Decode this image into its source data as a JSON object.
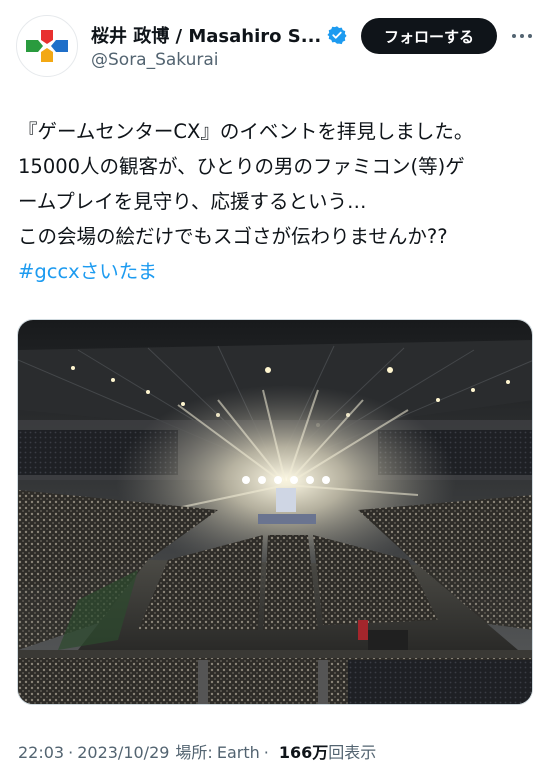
{
  "author": {
    "display_name": "桜井 政博 / Masahiro S...",
    "handle": "@Sora_Sakurai",
    "verified": true
  },
  "follow_button_label": "フォローする",
  "more_icon": "more-horizontal-icon",
  "tweet": {
    "lines": [
      "『ゲームセンターCX』のイベントを拝見しました。",
      "15000人の観客が、ひとりの男のファミコン(等)ゲ",
      "ームプレイを見守り、応援するという…",
      "この会場の絵だけでもスゴさが伝わりませんか??"
    ],
    "hashtag": "#gccxさいたま"
  },
  "media": {
    "kind": "photo"
  },
  "meta": {
    "time": "22:03",
    "separator": "·",
    "date": "2023/10/29",
    "location_label": "場所:",
    "location": "Earth",
    "views_count": "166万",
    "views_label": "回表示"
  },
  "colors": {
    "link": "#1d9bf0",
    "verified": "#1d9bf0",
    "button_bg": "#0f1419",
    "secondary_text": "#536471"
  }
}
